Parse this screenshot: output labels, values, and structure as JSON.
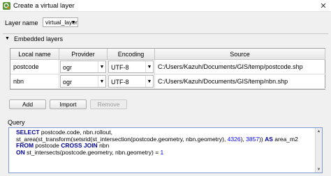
{
  "window": {
    "title": "Create a virtual layer",
    "close_glyph": "✕"
  },
  "layer": {
    "label": "Layer name",
    "value": "virtual_layer",
    "arrow": "▼"
  },
  "embedded": {
    "title": "Embedded layers",
    "collapse_glyph": "▼"
  },
  "table": {
    "headers": [
      "Local name",
      "Provider",
      "Encoding",
      "Source"
    ],
    "rows": [
      {
        "local_name": "postcode",
        "provider": "ogr",
        "encoding": "UTF-8",
        "source": "C:/Users/Kazuh/Documents/GIS/temp/postcode.shp"
      },
      {
        "local_name": "nbn",
        "provider": "ogr",
        "encoding": "UTF-8",
        "source": "C:/Users/Kazuh/Documents/GIS/temp/nbn.shp"
      }
    ],
    "combo_arrow": "▼"
  },
  "buttons": {
    "add": "Add",
    "import": "Import",
    "remove": "Remove"
  },
  "query": {
    "title": "Query",
    "line1": {
      "kw": "SELECT",
      "rest": " postcode.code, nbn.rollout,"
    },
    "line2": {
      "text": "st_area(st_transform(setsrid(st_intersection(postcode.geometry, nbn.geometry), ",
      "n1": "4326",
      "mid": "), ",
      "n2": "3857",
      "end": ")) ",
      "kw": "AS",
      "alias": " area_m2"
    },
    "line3": {
      "kw1": "FROM",
      "t1": " postcode ",
      "kw2": "CROSS JOIN",
      "t2": " nbn"
    },
    "line4": {
      "kw": "ON",
      "text": " st_intersects(postcode.geometry, nbn.geometry) = ",
      "n": "1"
    }
  },
  "colors": {
    "keyword": "#0000a0",
    "number": "#0000ff",
    "focus_border": "#7a9cd3"
  },
  "icons": {
    "app": "qgis-icon"
  }
}
